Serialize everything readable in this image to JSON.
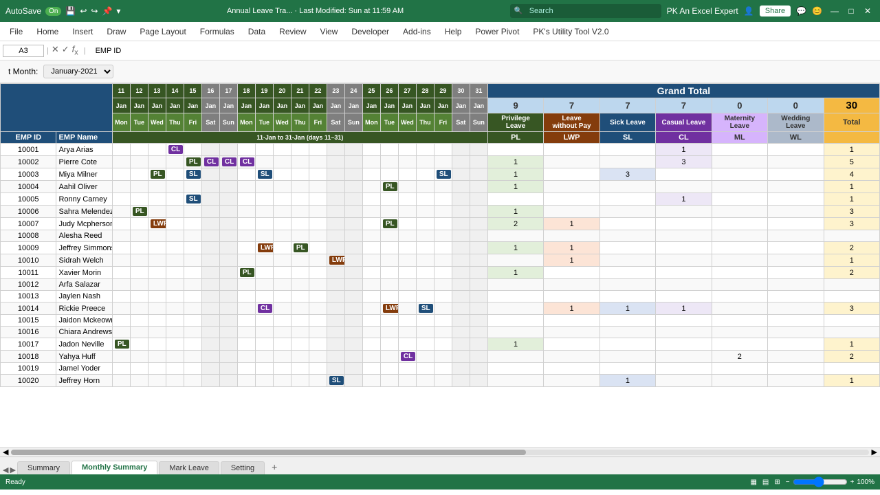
{
  "titlebar": {
    "autosave_label": "AutoSave",
    "autosave_state": "On",
    "title": "Annual Leave Tra... · Last Modified: Sun at 11:59 AM",
    "search_placeholder": "Search",
    "user": "PK An Excel Expert",
    "share_label": "Share"
  },
  "menubar": {
    "items": [
      "File",
      "Home",
      "Insert",
      "Draw",
      "Page Layout",
      "Formulas",
      "Data",
      "Review",
      "View",
      "Developer",
      "Add-ins",
      "Help",
      "Power Pivot",
      "PK's Utility Tool V2.0"
    ]
  },
  "formulabar": {
    "cell_ref": "A3",
    "formula": "EMP ID"
  },
  "filter": {
    "label": "t Month:",
    "value": "January-2021"
  },
  "grand_total_header": "Grand Total",
  "summary_numbers": [
    "9",
    "7",
    "7",
    "7",
    "0",
    "0",
    "30"
  ],
  "summary_col_labels": [
    "Privilege Leave",
    "Leave without Pay",
    "Sick Leave",
    "Casual Leave",
    "Maternity Leave",
    "Wedding Leave",
    "Total"
  ],
  "summary_col_abbr": [
    "PL",
    "LWP",
    "SL",
    "CL",
    "ML",
    "WL",
    ""
  ],
  "headers": {
    "emp_id": "EMP ID",
    "emp_name": "EMP Name",
    "dates": [
      "11-Jan",
      "12-Jan",
      "13-Jan",
      "14-Jan",
      "15-Jan",
      "16-Jan",
      "17-Jan",
      "18-Jan",
      "19-Jan",
      "20-Jan",
      "21-Jan",
      "22-Jan",
      "23-Jan",
      "24-Jan",
      "25-Jan",
      "26-Jan",
      "27-Jan",
      "28-Jan",
      "29-Jan",
      "30-Jan",
      "31-Jan"
    ],
    "days": [
      "Mon",
      "Tue",
      "Wed",
      "Thu",
      "Fri",
      "Sat",
      "Sun",
      "Mon",
      "Tue",
      "Wed",
      "Thu",
      "Fri",
      "Sat",
      "Sun",
      "Mon",
      "Tue",
      "Wed",
      "Thu",
      "Fri",
      "Sat",
      "Sun"
    ]
  },
  "employees": [
    {
      "id": "10001",
      "name": "Arya Arias",
      "leaves": {
        "14": "CL"
      },
      "pl": "",
      "lwp": "",
      "sl": "",
      "cl": "1",
      "ml": "",
      "wl": "",
      "total": "1"
    },
    {
      "id": "10002",
      "name": "Pierre Cote",
      "leaves": {
        "15": "PL",
        "16": "CL",
        "17": "CL",
        "18": "CL"
      },
      "pl": "1",
      "lwp": "",
      "sl": "",
      "cl": "3",
      "ml": "",
      "wl": "",
      "total": "5"
    },
    {
      "id": "10003",
      "name": "Miya Milner",
      "leaves": {
        "13": "PL",
        "15": "SL",
        "19": "SL",
        "29": "SL"
      },
      "pl": "1",
      "lwp": "",
      "sl": "3",
      "cl": "",
      "ml": "",
      "wl": "",
      "total": "4"
    },
    {
      "id": "10004",
      "name": "Aahil Oliver",
      "leaves": {
        "26": "PL"
      },
      "pl": "1",
      "lwp": "",
      "sl": "",
      "cl": "",
      "ml": "",
      "wl": "",
      "total": "1"
    },
    {
      "id": "10005",
      "name": "Ronny Carney",
      "leaves": {
        "15": "SL"
      },
      "pl": "",
      "lwp": "",
      "sl": "",
      "cl": "1",
      "ml": "",
      "wl": "",
      "total": "1"
    },
    {
      "id": "10006",
      "name": "Sahra Melendez",
      "leaves": {
        "12": "PL"
      },
      "pl": "1",
      "lwp": "",
      "sl": "",
      "cl": "",
      "ml": "",
      "wl": "",
      "total": "3"
    },
    {
      "id": "10007",
      "name": "Judy Mcpherson",
      "leaves": {
        "13": "LWP",
        "26": "PL"
      },
      "pl": "2",
      "lwp": "1",
      "sl": "",
      "cl": "",
      "ml": "",
      "wl": "",
      "total": "3"
    },
    {
      "id": "10008",
      "name": "Alesha Reed",
      "leaves": {},
      "pl": "",
      "lwp": "",
      "sl": "",
      "cl": "",
      "ml": "",
      "wl": "",
      "total": ""
    },
    {
      "id": "10009",
      "name": "Jeffrey Simmons",
      "leaves": {
        "19": "LWP",
        "21": "PL"
      },
      "pl": "1",
      "lwp": "1",
      "sl": "",
      "cl": "",
      "ml": "",
      "wl": "",
      "total": "2"
    },
    {
      "id": "10010",
      "name": "Sidrah Welch",
      "leaves": {
        "23": "LWP"
      },
      "pl": "",
      "lwp": "1",
      "sl": "",
      "cl": "",
      "ml": "",
      "wl": "",
      "total": "1"
    },
    {
      "id": "10011",
      "name": "Xavier Morin",
      "leaves": {
        "18": "PL"
      },
      "pl": "1",
      "lwp": "",
      "sl": "",
      "cl": "",
      "ml": "",
      "wl": "",
      "total": "2"
    },
    {
      "id": "10012",
      "name": "Arfa Salazar",
      "leaves": {},
      "pl": "",
      "lwp": "",
      "sl": "",
      "cl": "",
      "ml": "",
      "wl": "",
      "total": ""
    },
    {
      "id": "10013",
      "name": "Jaylen Nash",
      "leaves": {},
      "pl": "",
      "lwp": "",
      "sl": "",
      "cl": "",
      "ml": "",
      "wl": "",
      "total": ""
    },
    {
      "id": "10014",
      "name": "Rickie Preece",
      "leaves": {
        "19": "CL",
        "26": "LWP",
        "28": "SL"
      },
      "pl": "",
      "lwp": "1",
      "sl": "1",
      "cl": "1",
      "ml": "",
      "wl": "",
      "total": "3"
    },
    {
      "id": "10015",
      "name": "Jaidon Mckeown",
      "leaves": {},
      "pl": "",
      "lwp": "",
      "sl": "",
      "cl": "",
      "ml": "",
      "wl": "",
      "total": ""
    },
    {
      "id": "10016",
      "name": "Chiara Andrews",
      "leaves": {},
      "pl": "",
      "lwp": "",
      "sl": "",
      "cl": "",
      "ml": "",
      "wl": "",
      "total": ""
    },
    {
      "id": "10017",
      "name": "Jadon Neville",
      "leaves": {
        "11": "PL"
      },
      "pl": "1",
      "lwp": "",
      "sl": "",
      "cl": "",
      "ml": "",
      "wl": "",
      "total": "1"
    },
    {
      "id": "10018",
      "name": "Yahya Huff",
      "leaves": {
        "27": "CL"
      },
      "pl": "",
      "lwp": "",
      "sl": "",
      "cl": "",
      "ml": "2",
      "wl": "",
      "total": "2"
    },
    {
      "id": "10019",
      "name": "Jamel Yoder",
      "leaves": {},
      "pl": "",
      "lwp": "",
      "sl": "",
      "cl": "",
      "ml": "",
      "wl": "",
      "total": ""
    },
    {
      "id": "10020",
      "name": "Jeffrey Horn",
      "leaves": {
        "23": "SL"
      },
      "pl": "",
      "lwp": "",
      "sl": "1",
      "cl": "",
      "ml": "",
      "wl": "",
      "total": "1"
    }
  ],
  "tabs": [
    {
      "label": "Summary",
      "active": false
    },
    {
      "label": "Monthly Summary",
      "active": true
    },
    {
      "label": "Mark Leave",
      "active": false
    },
    {
      "label": "Setting",
      "active": false
    }
  ],
  "statusbar": {
    "ready": "Ready",
    "zoom": "100%"
  }
}
